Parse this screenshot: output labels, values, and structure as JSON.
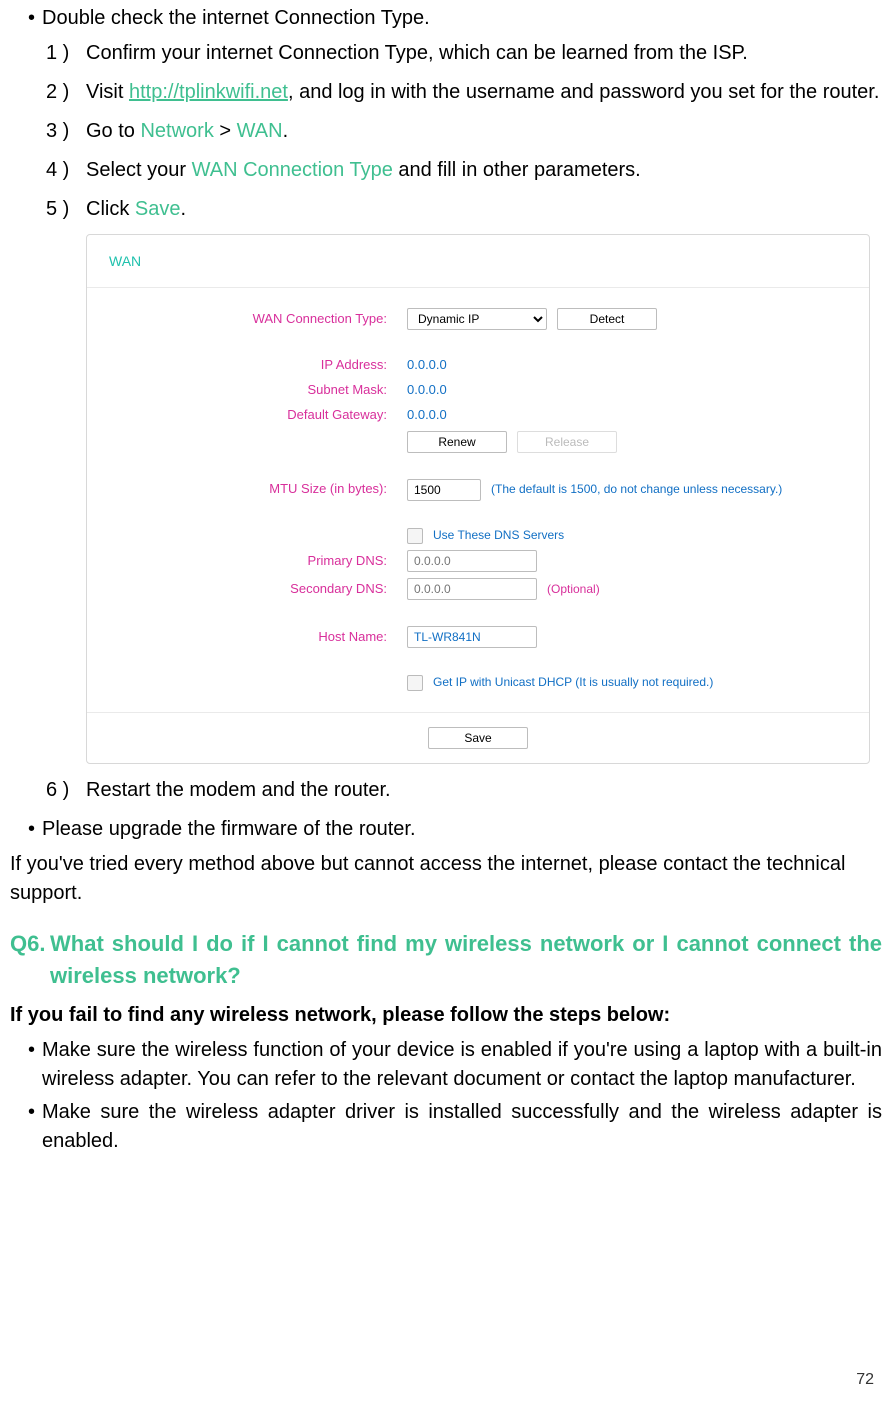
{
  "bullet_intro": "Double check the internet Connection Type.",
  "steps": {
    "s1": {
      "num": "1 )",
      "text": "Confirm your internet Connection Type, which can be learned from the ISP."
    },
    "s2": {
      "num": "2 )",
      "pre": "Visit ",
      "link": "http://tplinkwifi.net",
      "post": ", and log in with the username and password you set for the router."
    },
    "s3": {
      "num": "3 )",
      "pre": "Go to ",
      "g1": "Network",
      "mid": " > ",
      "g2": "WAN",
      "post": "."
    },
    "s4": {
      "num": "4 )",
      "pre": "Select your ",
      "g1": "WAN Connection Type",
      "post": " and fill in other parameters."
    },
    "s5": {
      "num": "5 )",
      "pre": "Click ",
      "g1": "Save",
      "post": "."
    },
    "s6": {
      "num": "6 )",
      "text": "Restart the modem and the router."
    }
  },
  "wan": {
    "title": "WAN",
    "labels": {
      "conn_type": "WAN Connection Type:",
      "ip": "IP Address:",
      "mask": "Subnet Mask:",
      "gw": "Default Gateway:",
      "mtu": "MTU Size (in bytes):",
      "pdns": "Primary DNS:",
      "sdns": "Secondary DNS:",
      "host": "Host Name:"
    },
    "values": {
      "conn_type": "Dynamic IP",
      "ip": "0.0.0.0",
      "mask": "0.0.0.0",
      "gw": "0.0.0.0",
      "mtu": "1500",
      "pdns_ph": "0.0.0.0",
      "sdns_ph": "0.0.0.0",
      "host": "TL-WR841N"
    },
    "buttons": {
      "detect": "Detect",
      "renew": "Renew",
      "release": "Release",
      "save": "Save"
    },
    "hints": {
      "mtu": "(The default is 1500, do not change unless necessary.)",
      "use_dns": "Use These DNS Servers",
      "optional": "(Optional)",
      "unicast": "Get IP with Unicast DHCP (It is usually not required.)"
    }
  },
  "after_panel": {
    "upgrade": "Please upgrade the firmware of the router.",
    "tried": "If you've tried every method above but cannot access the internet, please contact the technical support."
  },
  "q6": {
    "num": "Q6.",
    "title": "What should I do if I cannot find my wireless network or I cannot connect the wireless network?",
    "sub": "If you fail to find any wireless network, please follow the steps below:",
    "b1": "Make sure the wireless function of your device is enabled if you're using a laptop with a built-in wireless adapter. You can refer to the relevant document or contact the laptop manufacturer.",
    "b2": "Make sure the wireless adapter driver is installed successfully and the wireless adapter is enabled."
  },
  "page_number": "72"
}
